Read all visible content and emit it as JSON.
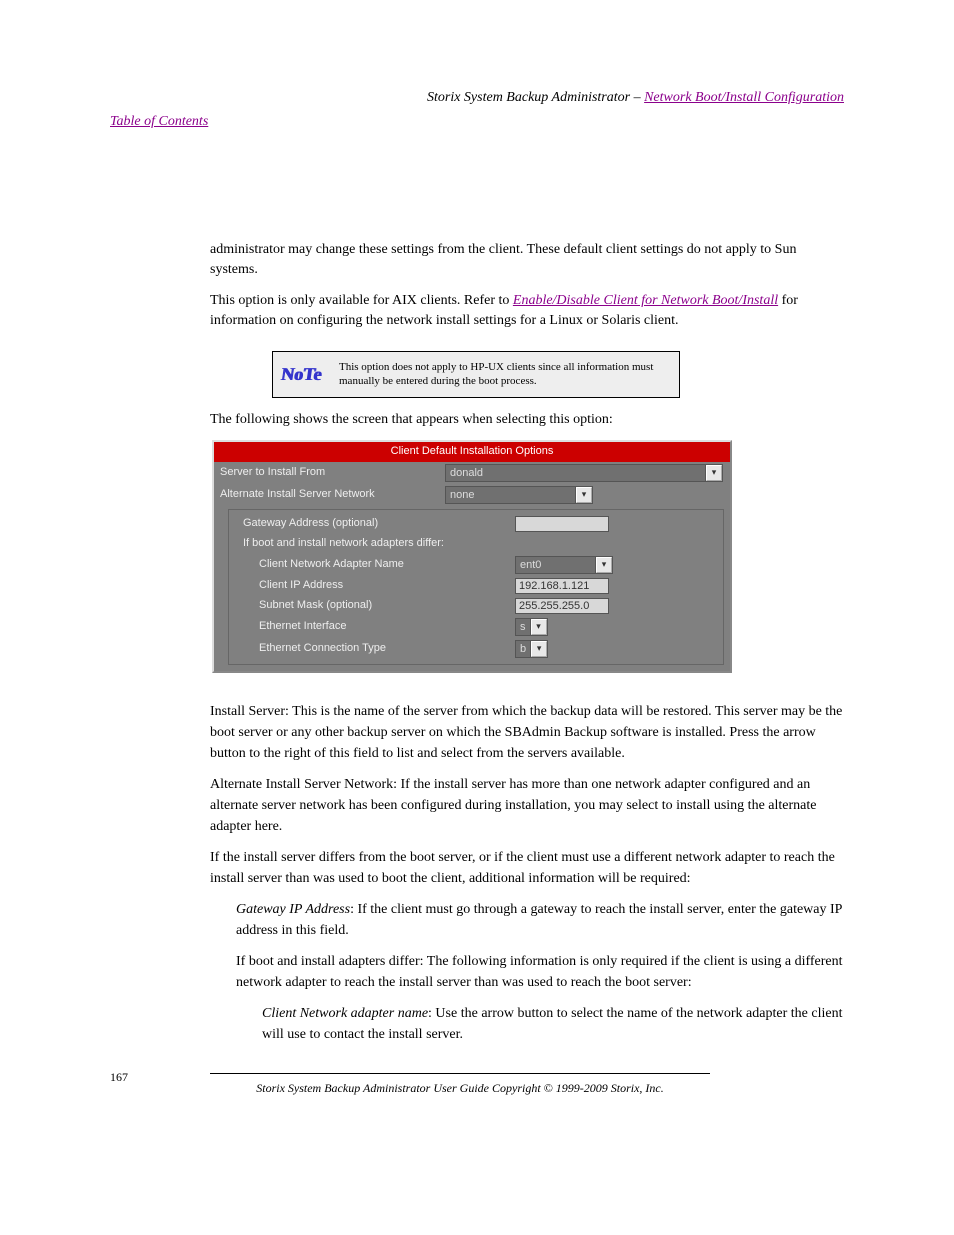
{
  "header": {
    "prefix": "Storix System Backup Administrator",
    "link": "Network Boot/Install Configuration"
  },
  "toc_link": "Table of Contents",
  "intro_text": "administrator may change these settings from the client. These default client settings do not apply to Sun systems.",
  "reference_sentence_prefix": "This option is only available for AIX clients. Refer to ",
  "reference_link": "Enable/Disable Client for Network Boot/Install",
  "reference_sentence_suffix": " for information on configuring the network install settings for a Linux or Solaris client.",
  "note_text": "This option does not apply to HP-UX clients since all information must manually be entered during the boot process.",
  "pre_shot_text": "The following shows the screen that appears when selecting this option:",
  "ui": {
    "title": "Client Default Installation Options",
    "server_to_install_label": "Server to Install From",
    "server_to_install_val": "donald",
    "alt_server_label": "Alternate Install Server Network",
    "alt_server_val": "none",
    "gateway_label": "Gateway Address (optional)",
    "gateway_val": "",
    "if_differ_text": "If boot and install network adapters differ:",
    "adapter_name_label": "Client Network Adapter Name",
    "adapter_name_val": "ent0",
    "client_ip_label": "Client IP Address",
    "client_ip_val": "192.168.1.121",
    "subnet_label": "Subnet Mask (optional)",
    "subnet_val": "255.255.255.0",
    "eth_if_label": "Ethernet Interface",
    "eth_if_val": "s",
    "eth_conn_label": "Ethernet Connection Type",
    "eth_conn_val": "b"
  },
  "body": {
    "p1": "Install Server: This is the name of the server from which the backup data will be restored. This server may be the boot server or any other backup server on which the SBAdmin Backup software is installed. Press the arrow button to the right of this field to list and select from the servers available.",
    "p2": "Alternate Install Server Network: If the install server has more than one network adapter configured and an alternate server network has been configured during installation, you may select to install using the alternate adapter here.",
    "p3": "If the install server differs from the boot server, or if the client must use a different network adapter to reach the install server than was used to boot the client, additional information will be required:",
    "p4_label": "Gateway IP Address",
    "p4_text": ": If the client must go through a gateway to reach the install server, enter the gateway IP address in this field.",
    "p5_text": "If boot and install adapters differ: The following information is only required if the client is using a different network adapter to reach the install server than was used to reach the boot server:",
    "p6_label": "Client Network adapter name",
    "p6_text": ": Use the arrow button to select the name of the network adapter the client will use to contact the install server."
  },
  "footer": "Storix System Backup Administrator User Guide\nCopyright © 1999-2009 Storix, Inc.",
  "page_number": "167"
}
